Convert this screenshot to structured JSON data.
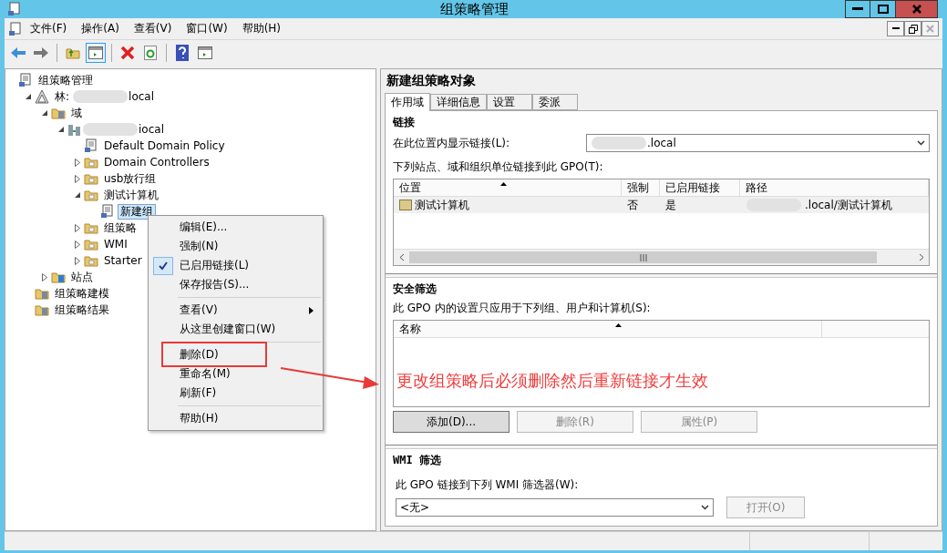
{
  "window": {
    "title": "组策略管理"
  },
  "menu_bar": [
    "文件(F)",
    "操作(A)",
    "查看(V)",
    "窗口(W)",
    "帮助(H)"
  ],
  "toolbar": [
    {
      "kind": "back",
      "pressed": false
    },
    {
      "kind": "forward",
      "pressed": false
    },
    {
      "kind": "sep"
    },
    {
      "kind": "up",
      "pressed": false
    },
    {
      "kind": "tree",
      "pressed": true
    },
    {
      "kind": "sep"
    },
    {
      "kind": "delete",
      "pressed": false
    },
    {
      "kind": "refresh",
      "pressed": false
    },
    {
      "kind": "sep"
    },
    {
      "kind": "help",
      "pressed": false
    },
    {
      "kind": "pane",
      "pressed": false
    }
  ],
  "tree": [
    {
      "label": "组策略管理",
      "kind": "console",
      "children": [
        {
          "label": "林:",
          "after_blur": "local",
          "kind": "forest",
          "expanded": true,
          "children": [
            {
              "label": "域",
              "kind": "domains",
              "expanded": true,
              "children": [
                {
                  "after_blur": "iocal",
                  "kind": "domain",
                  "expanded": true,
                  "children": [
                    {
                      "label": "Default Domain Policy",
                      "kind": "gpo",
                      "selected": false
                    },
                    {
                      "label": "Domain Controllers",
                      "kind": "ou",
                      "expanded": false
                    },
                    {
                      "label": "usb放行组",
                      "kind": "ou",
                      "expanded": false
                    },
                    {
                      "label": "测试计算机",
                      "kind": "ou",
                      "expanded": true,
                      "children": [
                        {
                          "label": "新建组",
                          "kind": "gpo",
                          "selected": true
                        }
                      ]
                    },
                    {
                      "label": "组策略",
                      "kind": "gpofolder",
                      "expanded": false
                    },
                    {
                      "label": "WMI",
                      "kind": "wmi",
                      "expanded": false
                    },
                    {
                      "label": "Starter",
                      "kind": "starter",
                      "expanded": false
                    }
                  ]
                }
              ]
            },
            {
              "label": "站点",
              "kind": "sites",
              "expanded": false
            }
          ]
        },
        {
          "label": "组策略建模",
          "kind": "modeling"
        },
        {
          "label": "组策略结果",
          "kind": "results"
        }
      ]
    }
  ],
  "details": {
    "title": "新建组策略对象",
    "tabs": [
      {
        "label": "作用域",
        "selected": true
      },
      {
        "label": "详细信息",
        "selected": false
      },
      {
        "label": "设置",
        "selected": false
      },
      {
        "label": "委派",
        "selected": false
      }
    ],
    "links": {
      "heading": "链接",
      "location_label": "在此位置内显示链接(L):",
      "location_value": ".local",
      "list_label": "下列站点、域和组织单位链接到此 GPO(T):",
      "columns": [
        "位置",
        "强制",
        "已启用链接",
        "路径"
      ],
      "rows": [
        {
          "cells": [
            "测试计算机",
            "否",
            "是",
            ".local/测试计算机"
          ],
          "selected": true
        }
      ]
    },
    "security": {
      "heading": "安全筛选",
      "label": "此 GPO 内的设置只应用于下列组、用户和计算机(S):",
      "columns": [
        "名称"
      ],
      "note": "更改组策略后必须删除然后重新链接才生效",
      "buttons": [
        {
          "label": "添加(D)...",
          "disabled": false
        },
        {
          "label": "删除(R)",
          "disabled": true
        },
        {
          "label": "属性(P)",
          "disabled": true
        }
      ]
    },
    "wmi": {
      "heading": "WMI 筛选",
      "label": "此 GPO 链接到下列 WMI 筛选器(W):",
      "value": "<无>",
      "button": {
        "label": "打开(O)",
        "disabled": true
      }
    }
  },
  "context_menu": [
    {
      "kind": "item",
      "label": "编辑(E)...",
      "checked": false,
      "submenu": false,
      "boxed": false
    },
    {
      "kind": "item",
      "label": "强制(N)",
      "checked": false,
      "submenu": false,
      "boxed": false
    },
    {
      "kind": "item",
      "label": "已启用链接(L)",
      "checked": true,
      "submenu": false,
      "boxed": false
    },
    {
      "kind": "item",
      "label": "保存报告(S)...",
      "checked": false,
      "submenu": false,
      "boxed": false
    },
    {
      "kind": "separator"
    },
    {
      "kind": "item",
      "label": "查看(V)",
      "checked": false,
      "submenu": true,
      "boxed": false
    },
    {
      "kind": "item",
      "label": "从这里创建窗口(W)",
      "checked": false,
      "submenu": false,
      "boxed": false
    },
    {
      "kind": "separator"
    },
    {
      "kind": "item",
      "label": "删除(D)",
      "checked": false,
      "submenu": false,
      "boxed": true
    },
    {
      "kind": "item",
      "label": "重命名(M)",
      "checked": false,
      "submenu": false,
      "boxed": false
    },
    {
      "kind": "item",
      "label": "刷新(F)",
      "checked": false,
      "submenu": false,
      "boxed": false
    },
    {
      "kind": "separator"
    },
    {
      "kind": "item",
      "label": "帮助(H)",
      "checked": false,
      "submenu": false,
      "boxed": false
    }
  ]
}
